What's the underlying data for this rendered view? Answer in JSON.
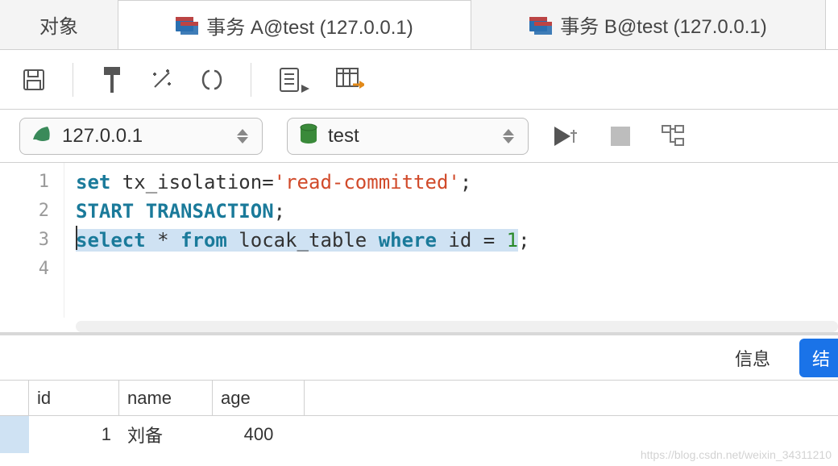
{
  "tabs": {
    "objects": "对象",
    "a": "事务 A@test (127.0.0.1)",
    "b": "事务 B@test (127.0.0.1)"
  },
  "combos": {
    "host": "127.0.0.1",
    "db": "test"
  },
  "code": {
    "lines": [
      "1",
      "2",
      "3",
      "4"
    ],
    "l1_set": "set",
    "l1_mid": " tx_isolation=",
    "l1_str": "'read-committed'",
    "l1_end": ";",
    "l2_a": "START",
    "l2_sp": " ",
    "l2_b": "TRANSACTION",
    "l2_end": ";",
    "l3_select": "select",
    "l3_sp1": " * ",
    "l3_from": "from",
    "l3_sp2": " locak_table ",
    "l3_where": "where",
    "l3_sp3": " id = ",
    "l3_num": "1",
    "l3_end": ";"
  },
  "info": {
    "label": "信息",
    "button": "结"
  },
  "grid": {
    "headers": {
      "id": "id",
      "name": "name",
      "age": "age"
    },
    "row": {
      "id": "1",
      "name": "刘备",
      "age": "400"
    }
  },
  "watermark": "https://blog.csdn.net/weixin_34311210"
}
